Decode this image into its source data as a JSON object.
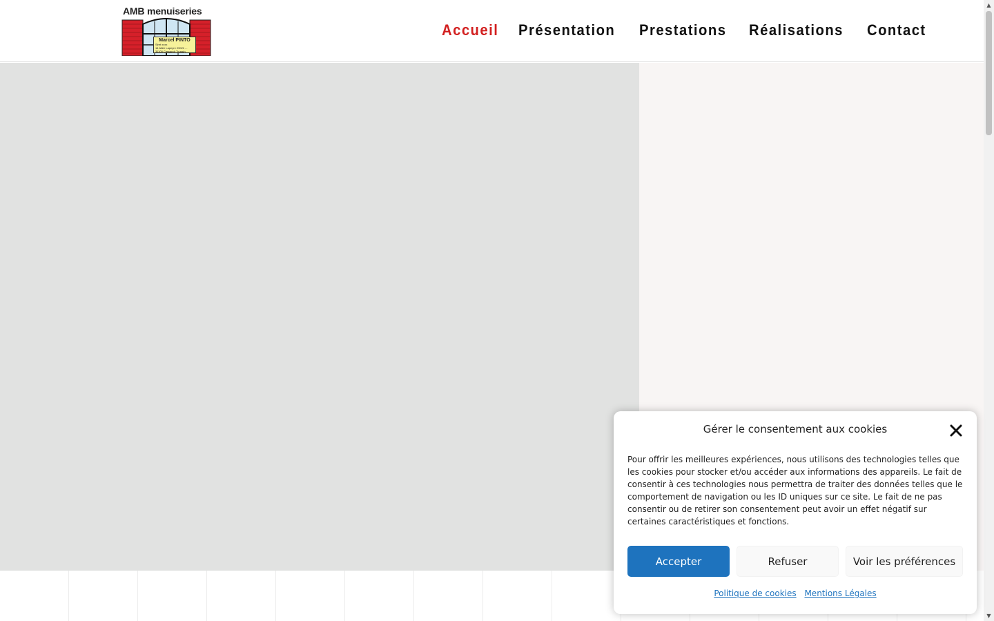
{
  "header": {
    "logo": {
      "title": "AMB menuiseries",
      "card_name": "Marcel PINTO",
      "card_lines": [
        "Siret xxxx",
        "14 Allée Lapeyre 29021 ...",
        "31100 Cassandr Toussin"
      ]
    },
    "nav": [
      {
        "label": "Accueil",
        "active": true
      },
      {
        "label": "Présentation",
        "active": false
      },
      {
        "label": "Prestations",
        "active": false
      },
      {
        "label": "Réalisations",
        "active": false
      },
      {
        "label": "Contact",
        "active": false
      }
    ]
  },
  "colors": {
    "accent": "#d21f1f",
    "primary_button": "#1e73be",
    "hero_left": "#e1e2e1",
    "hero_right": "#f8f5f4"
  },
  "cookie": {
    "title": "Gérer le consentement aux cookies",
    "text": "Pour offrir les meilleures expériences, nous utilisons des technologies telles que les cookies pour stocker et/ou accéder aux informations des appareils. Le fait de consentir à ces technologies nous permettra de traiter des données telles que le comportement de navigation ou les ID uniques sur ce site. Le fait de ne pas consentir ou de retirer son consentement peut avoir un effet négatif sur certaines caractéristiques et fonctions.",
    "accept_label": "Accepter",
    "refuse_label": "Refuser",
    "prefs_label": "Voir les préférences",
    "policy_link": "Politique de cookies",
    "legal_link": "Mentions Légales",
    "close_icon": "close-icon"
  }
}
